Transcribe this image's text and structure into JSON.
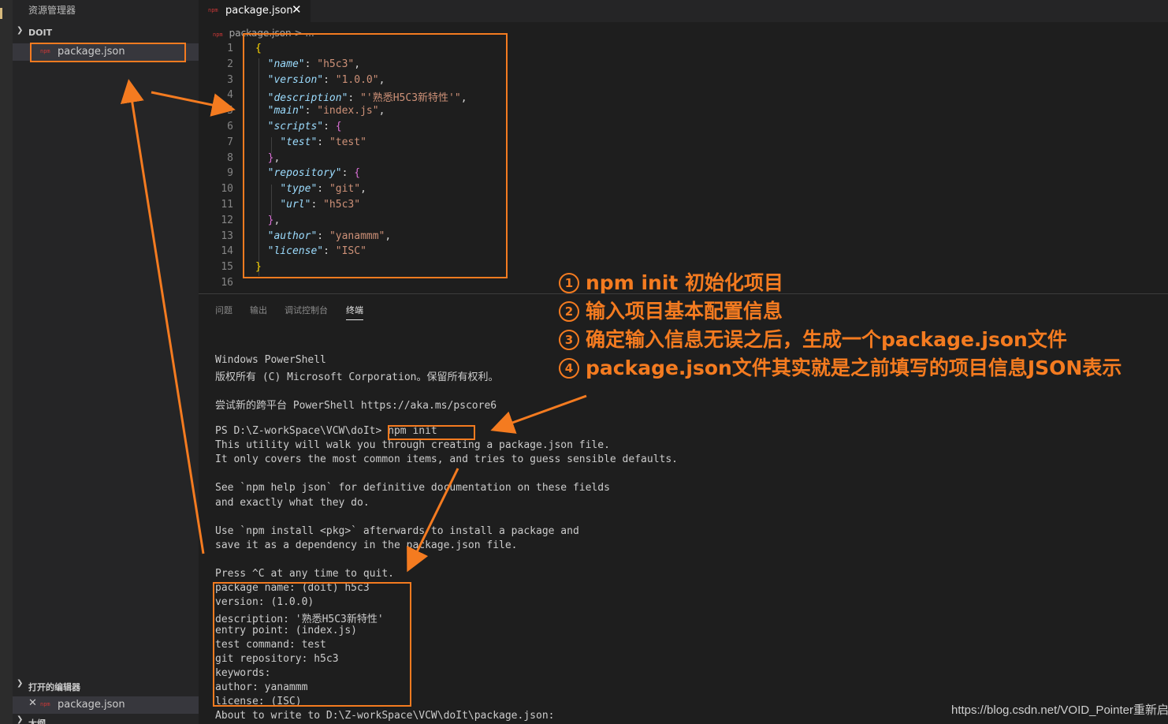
{
  "sidebar": {
    "title": "资源管理器",
    "folder_label": "DOIT",
    "file_icon": "json-file-icon",
    "file_label": "package.json",
    "open_editors_label": "打开的编辑器",
    "open_editor_file": "package.json",
    "outline_label": "大纲"
  },
  "editor": {
    "tab_label": "package.json",
    "breadcrumb": "package.json > ...",
    "lines": [
      {
        "n": "1",
        "parts": [
          {
            "t": "{",
            "c": "b1"
          }
        ]
      },
      {
        "n": "2",
        "parts": [
          {
            "t": "  ",
            "c": "p"
          },
          {
            "t": "\"name\"",
            "c": "k"
          },
          {
            "t": ": ",
            "c": "p"
          },
          {
            "t": "\"h5c3\"",
            "c": "s"
          },
          {
            "t": ",",
            "c": "p"
          }
        ]
      },
      {
        "n": "3",
        "parts": [
          {
            "t": "  ",
            "c": "p"
          },
          {
            "t": "\"version\"",
            "c": "k"
          },
          {
            "t": ": ",
            "c": "p"
          },
          {
            "t": "\"1.0.0\"",
            "c": "s"
          },
          {
            "t": ",",
            "c": "p"
          }
        ]
      },
      {
        "n": "4",
        "parts": [
          {
            "t": "  ",
            "c": "p"
          },
          {
            "t": "\"description\"",
            "c": "k"
          },
          {
            "t": ": ",
            "c": "p"
          },
          {
            "t": "\"'熟悉H5C3新特性'\"",
            "c": "s"
          },
          {
            "t": ",",
            "c": "p"
          }
        ]
      },
      {
        "n": "5",
        "parts": [
          {
            "t": "  ",
            "c": "p"
          },
          {
            "t": "\"main\"",
            "c": "k"
          },
          {
            "t": ": ",
            "c": "p"
          },
          {
            "t": "\"index.js\"",
            "c": "s"
          },
          {
            "t": ",",
            "c": "p"
          }
        ]
      },
      {
        "n": "6",
        "parts": [
          {
            "t": "  ",
            "c": "p"
          },
          {
            "t": "\"scripts\"",
            "c": "k"
          },
          {
            "t": ": ",
            "c": "p"
          },
          {
            "t": "{",
            "c": "b2"
          }
        ]
      },
      {
        "n": "7",
        "parts": [
          {
            "t": "    ",
            "c": "p"
          },
          {
            "t": "\"test\"",
            "c": "k"
          },
          {
            "t": ": ",
            "c": "p"
          },
          {
            "t": "\"test\"",
            "c": "s"
          }
        ]
      },
      {
        "n": "8",
        "parts": [
          {
            "t": "  ",
            "c": "p"
          },
          {
            "t": "}",
            "c": "b2"
          },
          {
            "t": ",",
            "c": "p"
          }
        ]
      },
      {
        "n": "9",
        "parts": [
          {
            "t": "  ",
            "c": "p"
          },
          {
            "t": "\"repository\"",
            "c": "k"
          },
          {
            "t": ": ",
            "c": "p"
          },
          {
            "t": "{",
            "c": "b2"
          }
        ]
      },
      {
        "n": "10",
        "parts": [
          {
            "t": "    ",
            "c": "p"
          },
          {
            "t": "\"type\"",
            "c": "k"
          },
          {
            "t": ": ",
            "c": "p"
          },
          {
            "t": "\"git\"",
            "c": "s"
          },
          {
            "t": ",",
            "c": "p"
          }
        ]
      },
      {
        "n": "11",
        "parts": [
          {
            "t": "    ",
            "c": "p"
          },
          {
            "t": "\"url\"",
            "c": "k"
          },
          {
            "t": ": ",
            "c": "p"
          },
          {
            "t": "\"h5c3\"",
            "c": "s"
          }
        ]
      },
      {
        "n": "12",
        "parts": [
          {
            "t": "  ",
            "c": "p"
          },
          {
            "t": "}",
            "c": "b2"
          },
          {
            "t": ",",
            "c": "p"
          }
        ]
      },
      {
        "n": "13",
        "parts": [
          {
            "t": "  ",
            "c": "p"
          },
          {
            "t": "\"author\"",
            "c": "k"
          },
          {
            "t": ": ",
            "c": "p"
          },
          {
            "t": "\"yanammm\"",
            "c": "s"
          },
          {
            "t": ",",
            "c": "p"
          }
        ]
      },
      {
        "n": "14",
        "parts": [
          {
            "t": "  ",
            "c": "p"
          },
          {
            "t": "\"license\"",
            "c": "k"
          },
          {
            "t": ": ",
            "c": "p"
          },
          {
            "t": "\"ISC\"",
            "c": "s"
          }
        ]
      },
      {
        "n": "15",
        "parts": [
          {
            "t": "}",
            "c": "b1"
          }
        ]
      },
      {
        "n": "16",
        "parts": []
      }
    ]
  },
  "panel": {
    "tabs": [
      "问题",
      "输出",
      "调试控制台",
      "终端"
    ],
    "active_tab": "终端"
  },
  "terminal": {
    "lines": [
      "Windows PowerShell",
      "版权所有 (C) Microsoft Corporation。保留所有权利。",
      "",
      "尝试新的跨平台 PowerShell https://aka.ms/pscore6",
      "",
      "PS D:\\Z-workSpace\\VCW\\doIt> npm init",
      "This utility will walk you through creating a package.json file.",
      "It only covers the most common items, and tries to guess sensible defaults.",
      "",
      "See `npm help json` for definitive documentation on these fields",
      "and exactly what they do.",
      "",
      "Use `npm install <pkg>` afterwards to install a package and",
      "save it as a dependency in the package.json file.",
      "",
      "Press ^C at any time to quit.",
      "package name: (doit) h5c3",
      "version: (1.0.0)",
      "description: '熟悉H5C3新特性'",
      "entry point: (index.js)",
      "test command: test",
      "git repository: h5c3",
      "keywords:",
      "author: yanammm",
      "license: (ISC)",
      "About to write to D:\\Z-workSpace\\VCW\\doIt\\package.json:"
    ]
  },
  "annotations": [
    {
      "num": "1",
      "text": "npm init 初始化项目"
    },
    {
      "num": "2",
      "text": "输入项目基本配置信息"
    },
    {
      "num": "3",
      "text": "确定输入信息无误之后，生成一个package.json文件"
    },
    {
      "num": "4",
      "text": "package.json文件其实就是之前填写的项目信息JSON表示"
    }
  ],
  "watermark": "https://blog.csdn.net/VOID_Pointer重新启",
  "colors": {
    "annotation": "#f47b20",
    "key": "#9cdcfe",
    "string": "#ce9178"
  }
}
